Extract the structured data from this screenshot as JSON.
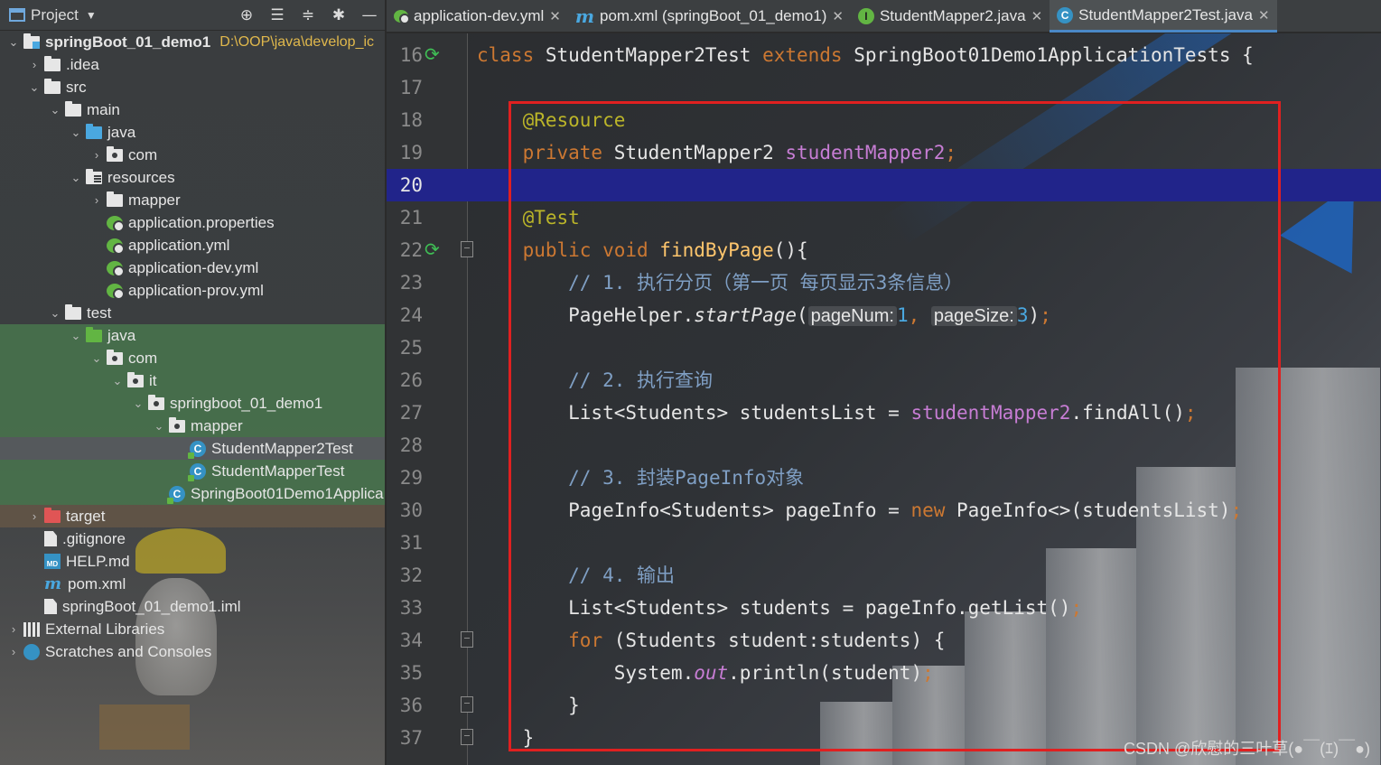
{
  "project_panel": {
    "title": "Project",
    "toolbar_icons": [
      "target-icon",
      "expand-all-icon",
      "collapse-all-icon",
      "gear-icon",
      "minimize-icon"
    ],
    "tree": [
      {
        "label": "springBoot_01_demo1",
        "path": "D:\\OOP\\java\\develop_ic",
        "depth": 0,
        "arrow": "open",
        "icon": "module-folder-icon",
        "bold": true
      },
      {
        "label": ".idea",
        "depth": 1,
        "arrow": "closed",
        "icon": "folder-icon"
      },
      {
        "label": "src",
        "depth": 1,
        "arrow": "open",
        "icon": "folder-icon"
      },
      {
        "label": "main",
        "depth": 2,
        "arrow": "open",
        "icon": "folder-icon"
      },
      {
        "label": "java",
        "depth": 3,
        "arrow": "open",
        "icon": "source-folder-icon"
      },
      {
        "label": "com",
        "depth": 4,
        "arrow": "closed",
        "icon": "package-icon"
      },
      {
        "label": "resources",
        "depth": 3,
        "arrow": "open",
        "icon": "resources-folder-icon"
      },
      {
        "label": "mapper",
        "depth": 4,
        "arrow": "closed",
        "icon": "folder-icon"
      },
      {
        "label": "application.properties",
        "depth": 4,
        "arrow": "none",
        "icon": "spring-config-icon"
      },
      {
        "label": "application.yml",
        "depth": 4,
        "arrow": "none",
        "icon": "spring-config-icon"
      },
      {
        "label": "application-dev.yml",
        "depth": 4,
        "arrow": "none",
        "icon": "spring-config-icon"
      },
      {
        "label": "application-prov.yml",
        "depth": 4,
        "arrow": "none",
        "icon": "spring-config-icon"
      },
      {
        "label": "test",
        "depth": 2,
        "arrow": "open",
        "icon": "folder-icon"
      },
      {
        "label": "java",
        "depth": 3,
        "arrow": "open",
        "icon": "test-folder-icon",
        "zone": "test"
      },
      {
        "label": "com",
        "depth": 4,
        "arrow": "open",
        "icon": "package-icon",
        "zone": "test"
      },
      {
        "label": "it",
        "depth": 5,
        "arrow": "open",
        "icon": "package-icon",
        "zone": "test"
      },
      {
        "label": "springboot_01_demo1",
        "depth": 6,
        "arrow": "open",
        "icon": "package-icon",
        "zone": "test"
      },
      {
        "label": "mapper",
        "depth": 7,
        "arrow": "open",
        "icon": "package-icon",
        "zone": "test"
      },
      {
        "label": "StudentMapper2Test",
        "depth": 8,
        "arrow": "none",
        "icon": "test-class-icon",
        "zone": "selected"
      },
      {
        "label": "StudentMapperTest",
        "depth": 8,
        "arrow": "none",
        "icon": "test-class-icon",
        "zone": "test"
      },
      {
        "label": "SpringBoot01Demo1Applica",
        "depth": 7,
        "arrow": "none",
        "icon": "test-class-icon",
        "zone": "test"
      },
      {
        "label": "target",
        "depth": 1,
        "arrow": "closed",
        "icon": "excluded-folder-icon",
        "zone": "excluded"
      },
      {
        "label": ".gitignore",
        "depth": 1,
        "arrow": "none",
        "icon": "file-icon"
      },
      {
        "label": "HELP.md",
        "depth": 1,
        "arrow": "none",
        "icon": "markdown-icon"
      },
      {
        "label": "pom.xml",
        "depth": 1,
        "arrow": "none",
        "icon": "maven-icon"
      },
      {
        "label": "springBoot_01_demo1.iml",
        "depth": 1,
        "arrow": "none",
        "icon": "file-icon"
      },
      {
        "label": "External Libraries",
        "depth": 0,
        "arrow": "closed",
        "icon": "library-icon"
      },
      {
        "label": "Scratches and Consoles",
        "depth": 0,
        "arrow": "closed",
        "icon": "scratches-icon"
      }
    ]
  },
  "tabs": [
    {
      "label": "application-dev.yml",
      "icon": "spring-config-icon",
      "active": false
    },
    {
      "label": "pom.xml (springBoot_01_demo1)",
      "icon": "maven-icon",
      "active": false
    },
    {
      "label": "StudentMapper2.java",
      "icon": "interface-icon",
      "active": false
    },
    {
      "label": "StudentMapper2Test.java",
      "icon": "class-icon",
      "active": true
    }
  ],
  "editor": {
    "current_line": 20,
    "lines": [
      {
        "n": "16",
        "run": true,
        "tokens": [
          [
            "kw",
            "class "
          ],
          [
            "txt",
            "StudentMapper2Test "
          ],
          [
            "kw",
            "extends "
          ],
          [
            "txt",
            "SpringBoot01Demo1ApplicationTests {"
          ]
        ]
      },
      {
        "n": "17",
        "tokens": []
      },
      {
        "n": "18",
        "tokens": [
          [
            "txt",
            "    "
          ],
          [
            "ann",
            "@Resource"
          ]
        ]
      },
      {
        "n": "19",
        "tokens": [
          [
            "txt",
            "    "
          ],
          [
            "kw",
            "private "
          ],
          [
            "txt",
            "StudentMapper2 "
          ],
          [
            "fld",
            "studentMapper2"
          ],
          [
            "semi",
            ";"
          ]
        ]
      },
      {
        "n": "20",
        "tokens": []
      },
      {
        "n": "21",
        "tokens": [
          [
            "txt",
            "    "
          ],
          [
            "ann",
            "@Test"
          ]
        ]
      },
      {
        "n": "22",
        "run": true,
        "fold": true,
        "tokens": [
          [
            "txt",
            "    "
          ],
          [
            "kw",
            "public void "
          ],
          [
            "fn",
            "findByPage"
          ],
          [
            "txt",
            "(){"
          ]
        ]
      },
      {
        "n": "23",
        "tokens": [
          [
            "txt",
            "        "
          ],
          [
            "cmt",
            "// 1. 执行分页（第一页 每页显示3条信息）"
          ]
        ]
      },
      {
        "n": "24",
        "tokens": [
          [
            "txt",
            "        PageHelper."
          ],
          [
            "txt it",
            "startPage"
          ],
          [
            "txt",
            "("
          ],
          [
            "hint",
            "pageNum:"
          ],
          [
            "num",
            "1"
          ],
          [
            "semi",
            ", "
          ],
          [
            "hint",
            "pageSize:"
          ],
          [
            "num",
            "3"
          ],
          [
            "txt",
            ")"
          ],
          [
            "semi",
            ";"
          ]
        ]
      },
      {
        "n": "25",
        "tokens": []
      },
      {
        "n": "26",
        "tokens": [
          [
            "txt",
            "        "
          ],
          [
            "cmt",
            "// 2. 执行查询"
          ]
        ]
      },
      {
        "n": "27",
        "tokens": [
          [
            "txt",
            "        List<Students> studentsList = "
          ],
          [
            "fld",
            "studentMapper2"
          ],
          [
            "txt",
            ".findAll()"
          ],
          [
            "semi",
            ";"
          ]
        ]
      },
      {
        "n": "28",
        "tokens": []
      },
      {
        "n": "29",
        "tokens": [
          [
            "txt",
            "        "
          ],
          [
            "cmt",
            "// 3. 封装PageInfo对象"
          ]
        ]
      },
      {
        "n": "30",
        "tokens": [
          [
            "txt",
            "        PageInfo<Students> pageInfo = "
          ],
          [
            "kw",
            "new "
          ],
          [
            "txt",
            "PageInfo<>(studentsList)"
          ],
          [
            "semi",
            ";"
          ]
        ]
      },
      {
        "n": "31",
        "tokens": []
      },
      {
        "n": "32",
        "tokens": [
          [
            "txt",
            "        "
          ],
          [
            "cmt",
            "// 4. 输出"
          ]
        ]
      },
      {
        "n": "33",
        "tokens": [
          [
            "txt",
            "        List<Students> students = pageInfo.getList()"
          ],
          [
            "semi",
            ";"
          ]
        ]
      },
      {
        "n": "34",
        "fold": true,
        "tokens": [
          [
            "txt",
            "        "
          ],
          [
            "kw",
            "for "
          ],
          [
            "txt",
            "(Students student:students) {"
          ]
        ]
      },
      {
        "n": "35",
        "tokens": [
          [
            "txt",
            "            System."
          ],
          [
            "fld it",
            "out"
          ],
          [
            "txt",
            ".println(student)"
          ],
          [
            "semi",
            ";"
          ]
        ]
      },
      {
        "n": "36",
        "fold": true,
        "tokens": [
          [
            "txt",
            "        }"
          ]
        ]
      },
      {
        "n": "37",
        "fold": true,
        "tokens": [
          [
            "txt",
            "    }"
          ]
        ]
      }
    ]
  },
  "watermark": "CSDN @欣慰的三叶草(●￣(ｴ)￣●)",
  "colors": {
    "keyword": "#cc7832",
    "annotation": "#bbb529",
    "field": "#c77dd4",
    "method": "#ffc66d",
    "comment": "#7f9fc4",
    "number": "#4aa8e0",
    "current_line": "#21248a",
    "highlight_box": "#e02020"
  }
}
